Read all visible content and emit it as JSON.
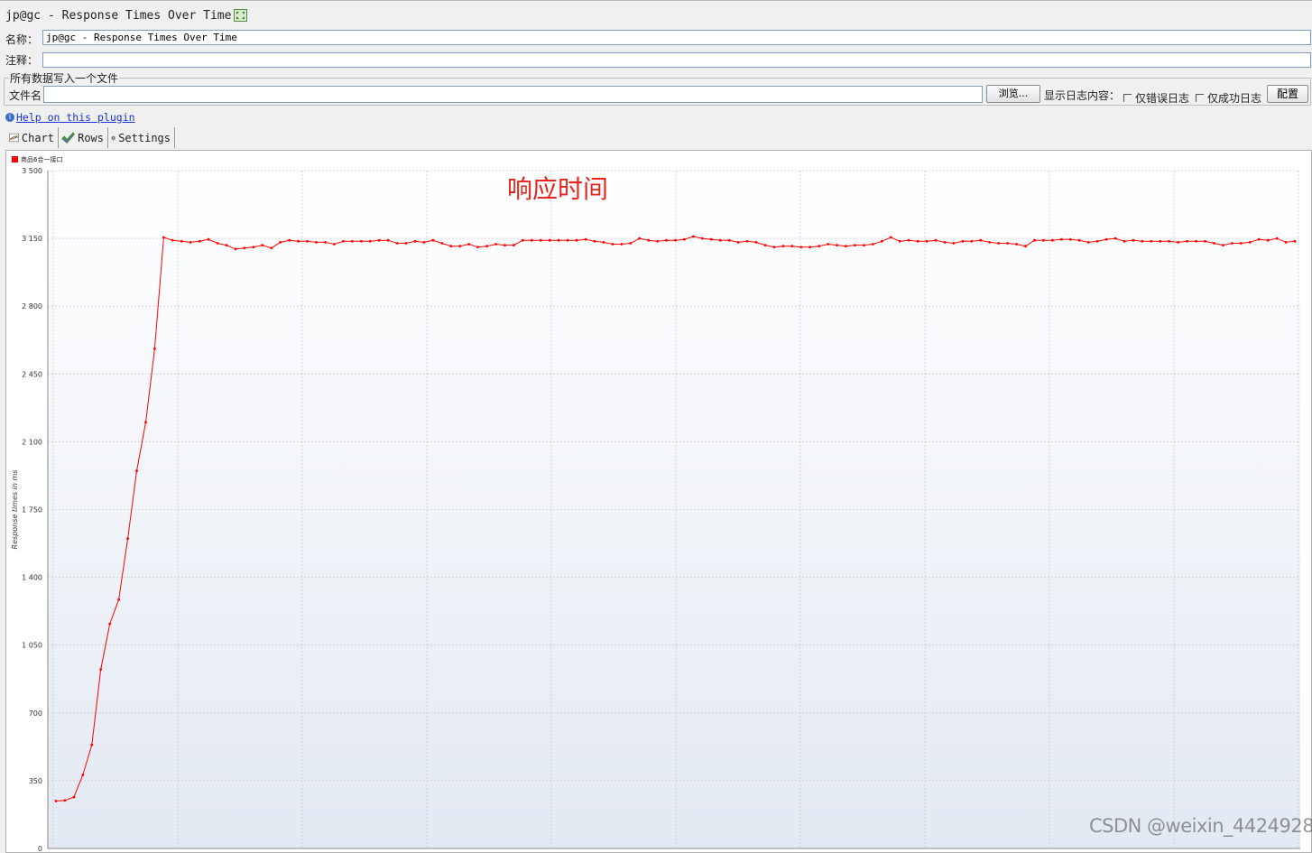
{
  "window": {
    "title": "jp@gc - Response Times Over Time"
  },
  "form": {
    "name_label": "名称：",
    "name_value": "jp@gc - Response Times Over Time",
    "comment_label": "注释：",
    "comment_value": "",
    "file_group_legend": "所有数据写入一个文件",
    "filename_label": "文件名",
    "filename_value": "",
    "browse_button": "浏览...",
    "log_content_label": "显示日志内容：",
    "errors_only_label": "仅错误日志",
    "success_only_label": "仅成功日志",
    "configure_button": "配置"
  },
  "help": {
    "link_text": "Help on this plugin"
  },
  "tabs": [
    {
      "label": "Chart",
      "icon": "line-chart-icon"
    },
    {
      "label": "Rows",
      "icon": "checkmark-icon"
    },
    {
      "label": "Settings",
      "icon": "gear-icon"
    }
  ],
  "chart_data": {
    "type": "line",
    "ylabel": "Response times in ms",
    "ylim": [
      0,
      3500
    ],
    "yticks": [
      "0",
      "350",
      "700",
      "1 050",
      "1 400",
      "1 750",
      "2 100",
      "2 450",
      "2 800",
      "3 150",
      "3 500"
    ],
    "grid": true,
    "legend": "top-left",
    "annotation": "响应时间",
    "series": [
      {
        "name": "商品6合一接口",
        "color": "#ff0000",
        "values": [
          245,
          248,
          265,
          380,
          535,
          925,
          1160,
          1285,
          1600,
          1950,
          2200,
          2580,
          3155,
          3140,
          3135,
          3130,
          3135,
          3145,
          3125,
          3115,
          3095,
          3100,
          3105,
          3115,
          3100,
          3130,
          3140,
          3135,
          3135,
          3130,
          3130,
          3120,
          3135,
          3135,
          3135,
          3135,
          3140,
          3140,
          3125,
          3125,
          3135,
          3130,
          3140,
          3125,
          3110,
          3110,
          3120,
          3105,
          3110,
          3120,
          3115,
          3115,
          3140,
          3140,
          3140,
          3140,
          3140,
          3140,
          3140,
          3145,
          3135,
          3130,
          3120,
          3120,
          3125,
          3150,
          3140,
          3135,
          3140,
          3140,
          3145,
          3160,
          3150,
          3145,
          3140,
          3140,
          3130,
          3135,
          3130,
          3115,
          3105,
          3110,
          3110,
          3105,
          3105,
          3110,
          3120,
          3115,
          3110,
          3115,
          3115,
          3120,
          3135,
          3155,
          3135,
          3140,
          3135,
          3135,
          3140,
          3130,
          3125,
          3135,
          3135,
          3140,
          3130,
          3125,
          3125,
          3120,
          3110,
          3140,
          3140,
          3140,
          3145,
          3145,
          3140,
          3130,
          3135,
          3145,
          3150,
          3135,
          3140,
          3135,
          3135,
          3135,
          3135,
          3130,
          3135,
          3135,
          3135,
          3125,
          3115,
          3125,
          3125,
          3130,
          3145,
          3140,
          3150,
          3130,
          3135
        ]
      }
    ]
  },
  "watermark": "CSDN @weixin_44249285"
}
